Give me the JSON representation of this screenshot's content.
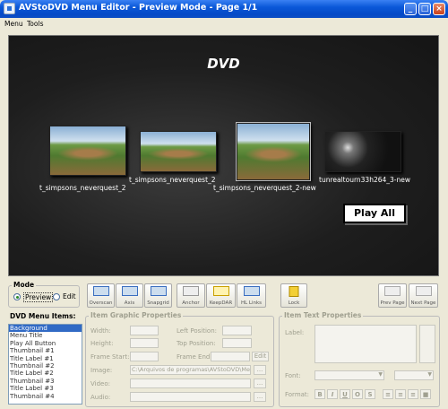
{
  "window": {
    "title": "AVStoDVD Menu Editor - Preview Mode - Page 1/1",
    "minimize": "_",
    "maximize": "□",
    "close": "×"
  },
  "menu": [
    "Menu",
    "Tools"
  ],
  "preview": {
    "title": "DVD",
    "thumbnails": [
      {
        "label": "t_simpsons_neverquest_2"
      },
      {
        "label": "t_simpsons_neverquest_2"
      },
      {
        "label": "t_simpsons_neverquest_2-new"
      },
      {
        "label": "tunrealtourn33h264_3-new"
      }
    ],
    "play_all": "Play All"
  },
  "mode": {
    "legend": "Mode",
    "preview": "Preview",
    "edit": "Edit",
    "selected": "Preview"
  },
  "toolbar": [
    "Overscan",
    "Axis",
    "Snapgrid",
    "Anchor",
    "KeepDAR",
    "HL Links"
  ],
  "lock": "Lock",
  "paging": {
    "prev": "Prev Page",
    "next": "Next Page"
  },
  "items": {
    "legend": "DVD Menu Items:",
    "list": [
      "Background",
      "Menu Title",
      "Play All Button",
      "Thumbnail #1",
      "Title Label #1",
      "Thumbnail #2",
      "Title Label #2",
      "Thumbnail #3",
      "Title Label #3",
      "Thumbnail #4"
    ],
    "selected": 0
  },
  "graphic": {
    "legend": "Item Graphic Properties",
    "width": "Width:",
    "height": "Height:",
    "left": "Left Position:",
    "top": "Top Position:",
    "frame_start": "Frame Start:",
    "frame_end": "Frame End:",
    "edit": "Edit",
    "image": "Image:",
    "image_value": "C:\\Arquivos de programas\\AVStoDVD\\Me",
    "video": "Video:",
    "audio": "Audio:",
    "browse": "..."
  },
  "text": {
    "legend": "Item Text Properties",
    "label": "Label:",
    "font": "Font:",
    "format": "Format:",
    "format_buttons": [
      "B",
      "I",
      "U",
      "O",
      "S"
    ]
  }
}
